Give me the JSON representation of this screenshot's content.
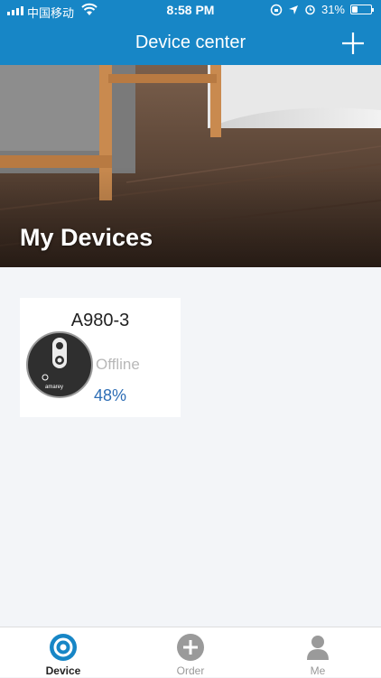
{
  "status_bar": {
    "carrier": "中国移动",
    "time": "8:58 PM",
    "battery_text": "31%",
    "battery_level": 0.31
  },
  "header": {
    "title": "Device center",
    "add_icon": "plus-icon",
    "background_color": "#1786c6"
  },
  "hero": {
    "title": "My Devices"
  },
  "devices": [
    {
      "name": "A980-3",
      "status": "Offline",
      "battery": "48%",
      "brand": "amarey",
      "icon": "robot-vacuum-icon"
    }
  ],
  "tabs": [
    {
      "label": "Device",
      "icon": "device-icon",
      "active": true
    },
    {
      "label": "Order",
      "icon": "order-plus-icon",
      "active": false
    },
    {
      "label": "Me",
      "icon": "person-icon",
      "active": false
    }
  ],
  "colors": {
    "accent": "#1786c6",
    "battery_text": "#2d6db5",
    "offline_text": "#b8b8b8"
  }
}
